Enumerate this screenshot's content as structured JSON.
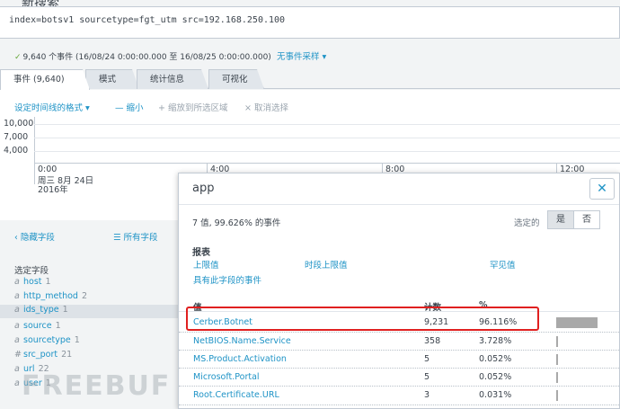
{
  "header": {
    "title_fragment": "新搜索",
    "query": "index=botsv1 sourcetype=fgt_utm src=192.168.250.100",
    "status": "9,640 个事件 (16/08/24 0:00:00.000 至 16/08/25 0:00:00.000)",
    "sampling": "无事件采样 ▾"
  },
  "tabs": [
    {
      "label": "事件 (9,640)",
      "active": true
    },
    {
      "label": "模式",
      "active": false
    },
    {
      "label": "统计信息",
      "active": false
    },
    {
      "label": "可视化",
      "active": false
    }
  ],
  "timeline": {
    "format_btn": "设定时间线的格式 ▾",
    "zoom_out": "— 缩小",
    "zoom_sel": "+ 缩放到所选区域",
    "deselect": "× 取消选择",
    "y_labels": [
      "10,000",
      "7,000",
      "4,000"
    ],
    "x_first": [
      "0:00",
      "周三 8月 24日",
      "2016年"
    ],
    "x_labels": [
      "4:00",
      "8:00",
      "12:00"
    ]
  },
  "sidebar": {
    "hide_fields": "‹ 隐藏字段",
    "all_fields": "☰ 所有字段",
    "selected_title": "选定字段",
    "fields": [
      {
        "type": "a",
        "name": "host",
        "count": "1",
        "selected": false
      },
      {
        "type": "a",
        "name": "http_method",
        "count": "2",
        "selected": false
      },
      {
        "type": "a",
        "name": "ids_type",
        "count": "1",
        "selected": true
      },
      {
        "type": "a",
        "name": "source",
        "count": "1",
        "selected": false
      },
      {
        "type": "a",
        "name": "sourcetype",
        "count": "1",
        "selected": false
      },
      {
        "type": "#",
        "name": "src_port",
        "count": "21",
        "selected": false
      },
      {
        "type": "a",
        "name": "url",
        "count": "22",
        "selected": false
      },
      {
        "type": "a",
        "name": "user",
        "count": "1",
        "selected": false
      }
    ]
  },
  "popup": {
    "title": "app",
    "close": "✕",
    "summary": "7 值, 99.626% 的事件",
    "selected_label": "选定的",
    "yes": "是",
    "no": "否",
    "reports_title": "报表",
    "report_links": [
      "上限值",
      "时段上限值",
      "罕见值",
      "具有此字段的事件"
    ],
    "col_value": "值",
    "col_count": "计数",
    "col_pct": "%",
    "rows": [
      {
        "value": "Cerber.Botnet",
        "count": "9,231",
        "pct": "96.116%",
        "ratio": 0.96116
      },
      {
        "value": "NetBIOS.Name.Service",
        "count": "358",
        "pct": "3.728%",
        "ratio": 0.03728
      },
      {
        "value": "MS.Product.Activation",
        "count": "5",
        "pct": "0.052%",
        "ratio": 0.00052
      },
      {
        "value": "Microsoft.Portal",
        "count": "5",
        "pct": "0.052%",
        "ratio": 0.00052
      },
      {
        "value": "Root.Certificate.URL",
        "count": "3",
        "pct": "0.031%",
        "ratio": 0.00031
      }
    ]
  },
  "watermark": "FREEBUF",
  "colors": {
    "link": "#1e93c6",
    "highlight": "#e02020",
    "check": "#65a637"
  }
}
